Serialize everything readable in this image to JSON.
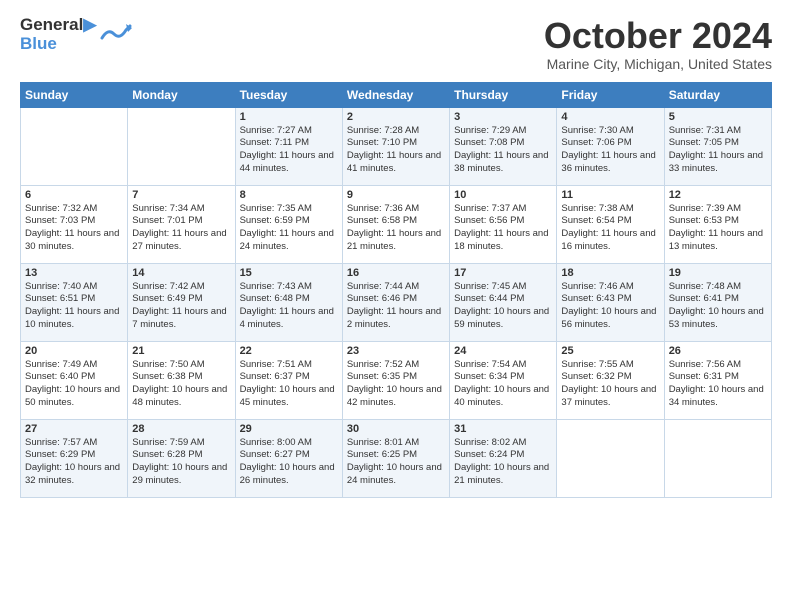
{
  "header": {
    "logo_line1": "General",
    "logo_line2": "Blue",
    "month": "October 2024",
    "location": "Marine City, Michigan, United States"
  },
  "days_of_week": [
    "Sunday",
    "Monday",
    "Tuesday",
    "Wednesday",
    "Thursday",
    "Friday",
    "Saturday"
  ],
  "weeks": [
    [
      {
        "day": "",
        "info": ""
      },
      {
        "day": "",
        "info": ""
      },
      {
        "day": "1",
        "info": "Sunrise: 7:27 AM\nSunset: 7:11 PM\nDaylight: 11 hours and 44 minutes."
      },
      {
        "day": "2",
        "info": "Sunrise: 7:28 AM\nSunset: 7:10 PM\nDaylight: 11 hours and 41 minutes."
      },
      {
        "day": "3",
        "info": "Sunrise: 7:29 AM\nSunset: 7:08 PM\nDaylight: 11 hours and 38 minutes."
      },
      {
        "day": "4",
        "info": "Sunrise: 7:30 AM\nSunset: 7:06 PM\nDaylight: 11 hours and 36 minutes."
      },
      {
        "day": "5",
        "info": "Sunrise: 7:31 AM\nSunset: 7:05 PM\nDaylight: 11 hours and 33 minutes."
      }
    ],
    [
      {
        "day": "6",
        "info": "Sunrise: 7:32 AM\nSunset: 7:03 PM\nDaylight: 11 hours and 30 minutes."
      },
      {
        "day": "7",
        "info": "Sunrise: 7:34 AM\nSunset: 7:01 PM\nDaylight: 11 hours and 27 minutes."
      },
      {
        "day": "8",
        "info": "Sunrise: 7:35 AM\nSunset: 6:59 PM\nDaylight: 11 hours and 24 minutes."
      },
      {
        "day": "9",
        "info": "Sunrise: 7:36 AM\nSunset: 6:58 PM\nDaylight: 11 hours and 21 minutes."
      },
      {
        "day": "10",
        "info": "Sunrise: 7:37 AM\nSunset: 6:56 PM\nDaylight: 11 hours and 18 minutes."
      },
      {
        "day": "11",
        "info": "Sunrise: 7:38 AM\nSunset: 6:54 PM\nDaylight: 11 hours and 16 minutes."
      },
      {
        "day": "12",
        "info": "Sunrise: 7:39 AM\nSunset: 6:53 PM\nDaylight: 11 hours and 13 minutes."
      }
    ],
    [
      {
        "day": "13",
        "info": "Sunrise: 7:40 AM\nSunset: 6:51 PM\nDaylight: 11 hours and 10 minutes."
      },
      {
        "day": "14",
        "info": "Sunrise: 7:42 AM\nSunset: 6:49 PM\nDaylight: 11 hours and 7 minutes."
      },
      {
        "day": "15",
        "info": "Sunrise: 7:43 AM\nSunset: 6:48 PM\nDaylight: 11 hours and 4 minutes."
      },
      {
        "day": "16",
        "info": "Sunrise: 7:44 AM\nSunset: 6:46 PM\nDaylight: 11 hours and 2 minutes."
      },
      {
        "day": "17",
        "info": "Sunrise: 7:45 AM\nSunset: 6:44 PM\nDaylight: 10 hours and 59 minutes."
      },
      {
        "day": "18",
        "info": "Sunrise: 7:46 AM\nSunset: 6:43 PM\nDaylight: 10 hours and 56 minutes."
      },
      {
        "day": "19",
        "info": "Sunrise: 7:48 AM\nSunset: 6:41 PM\nDaylight: 10 hours and 53 minutes."
      }
    ],
    [
      {
        "day": "20",
        "info": "Sunrise: 7:49 AM\nSunset: 6:40 PM\nDaylight: 10 hours and 50 minutes."
      },
      {
        "day": "21",
        "info": "Sunrise: 7:50 AM\nSunset: 6:38 PM\nDaylight: 10 hours and 48 minutes."
      },
      {
        "day": "22",
        "info": "Sunrise: 7:51 AM\nSunset: 6:37 PM\nDaylight: 10 hours and 45 minutes."
      },
      {
        "day": "23",
        "info": "Sunrise: 7:52 AM\nSunset: 6:35 PM\nDaylight: 10 hours and 42 minutes."
      },
      {
        "day": "24",
        "info": "Sunrise: 7:54 AM\nSunset: 6:34 PM\nDaylight: 10 hours and 40 minutes."
      },
      {
        "day": "25",
        "info": "Sunrise: 7:55 AM\nSunset: 6:32 PM\nDaylight: 10 hours and 37 minutes."
      },
      {
        "day": "26",
        "info": "Sunrise: 7:56 AM\nSunset: 6:31 PM\nDaylight: 10 hours and 34 minutes."
      }
    ],
    [
      {
        "day": "27",
        "info": "Sunrise: 7:57 AM\nSunset: 6:29 PM\nDaylight: 10 hours and 32 minutes."
      },
      {
        "day": "28",
        "info": "Sunrise: 7:59 AM\nSunset: 6:28 PM\nDaylight: 10 hours and 29 minutes."
      },
      {
        "day": "29",
        "info": "Sunrise: 8:00 AM\nSunset: 6:27 PM\nDaylight: 10 hours and 26 minutes."
      },
      {
        "day": "30",
        "info": "Sunrise: 8:01 AM\nSunset: 6:25 PM\nDaylight: 10 hours and 24 minutes."
      },
      {
        "day": "31",
        "info": "Sunrise: 8:02 AM\nSunset: 6:24 PM\nDaylight: 10 hours and 21 minutes."
      },
      {
        "day": "",
        "info": ""
      },
      {
        "day": "",
        "info": ""
      }
    ]
  ]
}
